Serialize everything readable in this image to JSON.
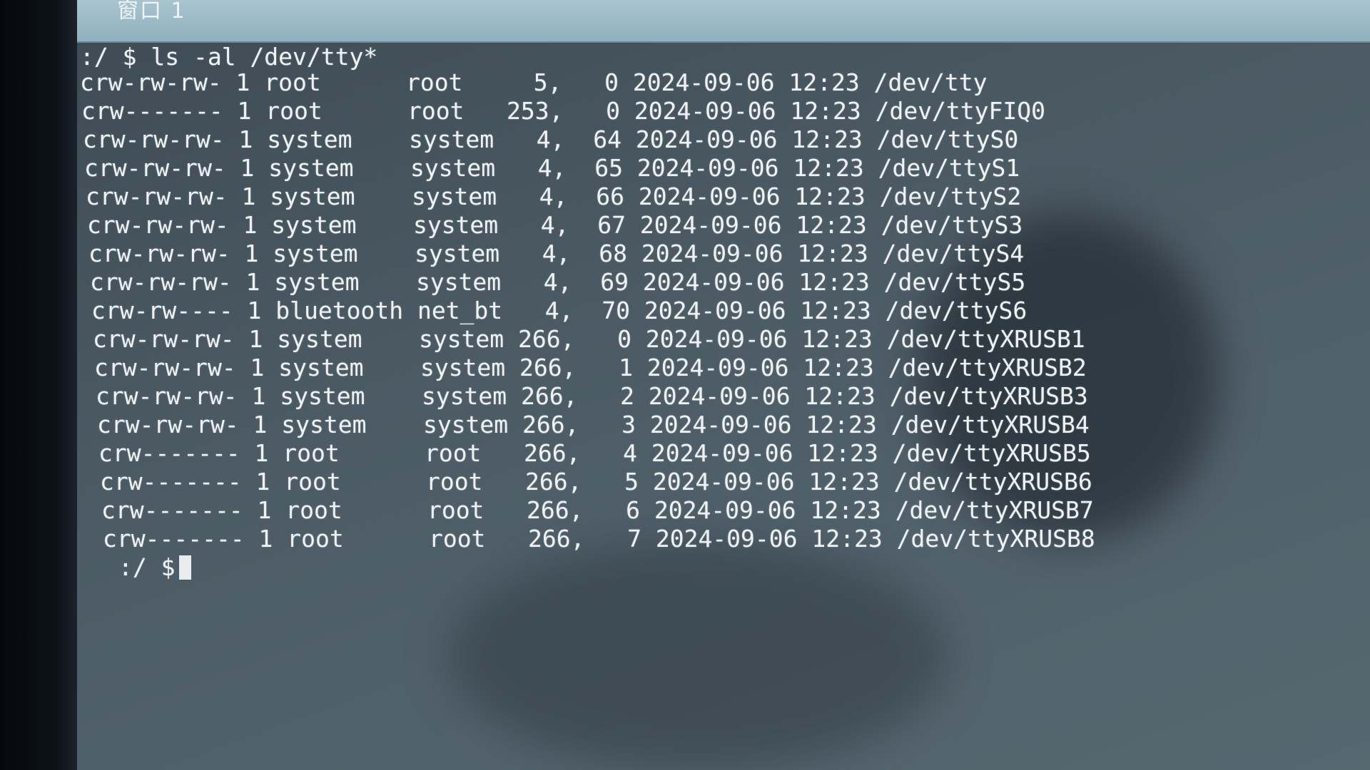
{
  "window": {
    "title": "窗口 1"
  },
  "terminal": {
    "command_prompt": ":/ $",
    "command": "ls -al /dev/tty*",
    "entries": [
      {
        "perms": "crw-rw-rw-",
        "links": "1",
        "owner": "root",
        "group": "root",
        "major": "5,",
        "minor": "0",
        "date": "2024-09-06",
        "time": "12:23",
        "path": "/dev/tty"
      },
      {
        "perms": "crw-------",
        "links": "1",
        "owner": "root",
        "group": "root",
        "major": "253,",
        "minor": "0",
        "date": "2024-09-06",
        "time": "12:23",
        "path": "/dev/ttyFIQ0"
      },
      {
        "perms": "crw-rw-rw-",
        "links": "1",
        "owner": "system",
        "group": "system",
        "major": "4,",
        "minor": "64",
        "date": "2024-09-06",
        "time": "12:23",
        "path": "/dev/ttyS0"
      },
      {
        "perms": "crw-rw-rw-",
        "links": "1",
        "owner": "system",
        "group": "system",
        "major": "4,",
        "minor": "65",
        "date": "2024-09-06",
        "time": "12:23",
        "path": "/dev/ttyS1"
      },
      {
        "perms": "crw-rw-rw-",
        "links": "1",
        "owner": "system",
        "group": "system",
        "major": "4,",
        "minor": "66",
        "date": "2024-09-06",
        "time": "12:23",
        "path": "/dev/ttyS2"
      },
      {
        "perms": "crw-rw-rw-",
        "links": "1",
        "owner": "system",
        "group": "system",
        "major": "4,",
        "minor": "67",
        "date": "2024-09-06",
        "time": "12:23",
        "path": "/dev/ttyS3"
      },
      {
        "perms": "crw-rw-rw-",
        "links": "1",
        "owner": "system",
        "group": "system",
        "major": "4,",
        "minor": "68",
        "date": "2024-09-06",
        "time": "12:23",
        "path": "/dev/ttyS4"
      },
      {
        "perms": "crw-rw-rw-",
        "links": "1",
        "owner": "system",
        "group": "system",
        "major": "4,",
        "minor": "69",
        "date": "2024-09-06",
        "time": "12:23",
        "path": "/dev/ttyS5"
      },
      {
        "perms": "crw-rw----",
        "links": "1",
        "owner": "bluetooth",
        "group": "net_bt",
        "major": "4,",
        "minor": "70",
        "date": "2024-09-06",
        "time": "12:23",
        "path": "/dev/ttyS6"
      },
      {
        "perms": "crw-rw-rw-",
        "links": "1",
        "owner": "system",
        "group": "system",
        "major": "266,",
        "minor": "0",
        "date": "2024-09-06",
        "time": "12:23",
        "path": "/dev/ttyXRUSB1"
      },
      {
        "perms": "crw-rw-rw-",
        "links": "1",
        "owner": "system",
        "group": "system",
        "major": "266,",
        "minor": "1",
        "date": "2024-09-06",
        "time": "12:23",
        "path": "/dev/ttyXRUSB2"
      },
      {
        "perms": "crw-rw-rw-",
        "links": "1",
        "owner": "system",
        "group": "system",
        "major": "266,",
        "minor": "2",
        "date": "2024-09-06",
        "time": "12:23",
        "path": "/dev/ttyXRUSB3"
      },
      {
        "perms": "crw-rw-rw-",
        "links": "1",
        "owner": "system",
        "group": "system",
        "major": "266,",
        "minor": "3",
        "date": "2024-09-06",
        "time": "12:23",
        "path": "/dev/ttyXRUSB4"
      },
      {
        "perms": "crw-------",
        "links": "1",
        "owner": "root",
        "group": "root",
        "major": "266,",
        "minor": "4",
        "date": "2024-09-06",
        "time": "12:23",
        "path": "/dev/ttyXRUSB5"
      },
      {
        "perms": "crw-------",
        "links": "1",
        "owner": "root",
        "group": "root",
        "major": "266,",
        "minor": "5",
        "date": "2024-09-06",
        "time": "12:23",
        "path": "/dev/ttyXRUSB6"
      },
      {
        "perms": "crw-------",
        "links": "1",
        "owner": "root",
        "group": "root",
        "major": "266,",
        "minor": "6",
        "date": "2024-09-06",
        "time": "12:23",
        "path": "/dev/ttyXRUSB7"
      },
      {
        "perms": "crw-------",
        "links": "1",
        "owner": "root",
        "group": "root",
        "major": "266,",
        "minor": "7",
        "date": "2024-09-06",
        "time": "12:23",
        "path": "/dev/ttyXRUSB8"
      }
    ],
    "final_prompt": ":/ $"
  },
  "colors": {
    "terminal_text": "#eef2f4",
    "terminal_background": "#4a5962",
    "header_strip": "#a9c4cf"
  }
}
